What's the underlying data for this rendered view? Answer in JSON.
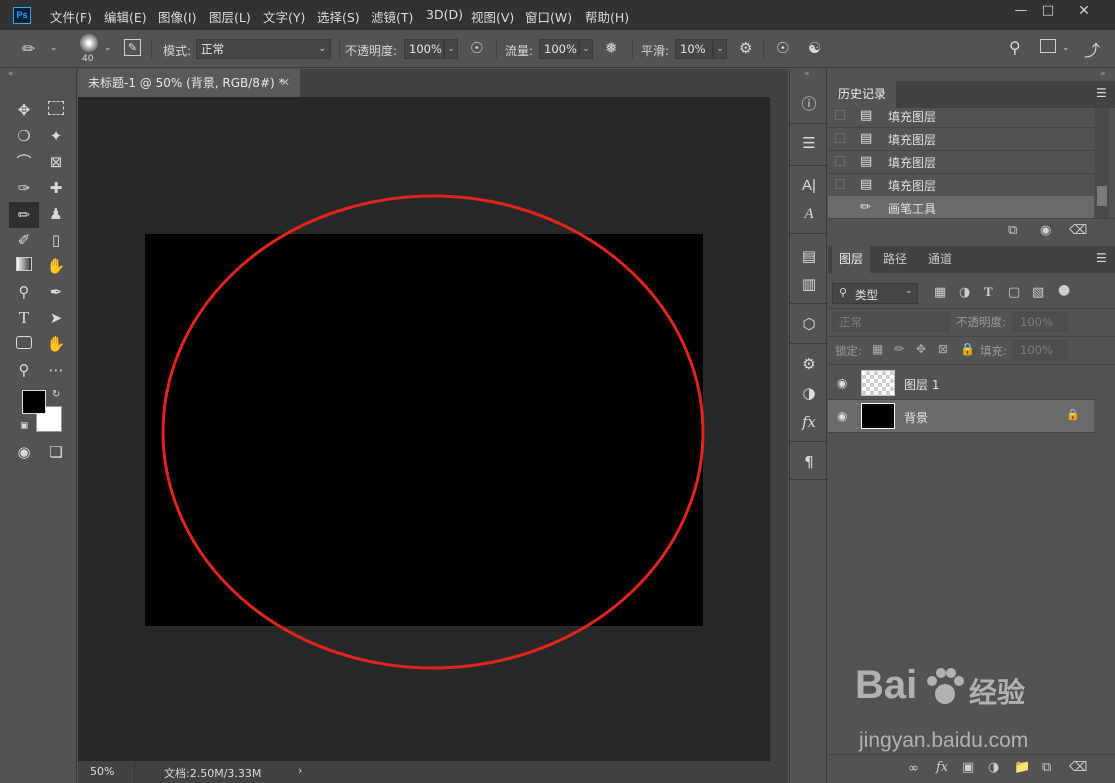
{
  "app": {
    "logo": "Ps"
  },
  "menu": [
    "文件(F)",
    "编辑(E)",
    "图像(I)",
    "图层(L)",
    "文字(Y)",
    "选择(S)",
    "滤镜(T)",
    "3D(D)",
    "视图(V)",
    "窗口(W)",
    "帮助(H)"
  ],
  "options": {
    "brush_size": "40",
    "mode_label": "模式:",
    "mode_value": "正常",
    "opacity_label": "不透明度:",
    "opacity_value": "100%",
    "flow_label": "流量:",
    "flow_value": "100%",
    "smooth_label": "平滑:",
    "smooth_value": "10%"
  },
  "document": {
    "tab_title": "未标题-1 @ 50% (背景, RGB/8#) *",
    "zoom": "50%",
    "doc_info": "文档:2.50M/3.33M",
    "canvas_color": "#000000",
    "annotation_color": "#e0261b"
  },
  "history": {
    "tab_label": "历史记录",
    "items": [
      {
        "label": "填充图层",
        "icon": "document-icon",
        "active": false
      },
      {
        "label": "填充图层",
        "icon": "document-icon",
        "active": false
      },
      {
        "label": "填充图层",
        "icon": "document-icon",
        "active": false
      },
      {
        "label": "填充图层",
        "icon": "document-icon",
        "active": false
      },
      {
        "label": "画笔工具",
        "icon": "brush-icon",
        "active": true
      }
    ]
  },
  "layers_panel": {
    "tabs": [
      "图层",
      "路径",
      "通道"
    ],
    "filter_label": "类型",
    "blend_mode": "正常",
    "opacity_label": "不透明度:",
    "opacity_value": "100%",
    "lock_label": "锁定:",
    "fill_label": "填充:",
    "fill_value": "100%",
    "layers": [
      {
        "name": "图层 1",
        "thumbnail": "transparent",
        "selected": false,
        "locked": false
      },
      {
        "name": "背景",
        "thumbnail": "black",
        "selected": true,
        "locked": true
      }
    ]
  },
  "watermark": {
    "brand": "Bai",
    "brand_suffix": "经验",
    "url": "jingyan.baidu.com"
  }
}
